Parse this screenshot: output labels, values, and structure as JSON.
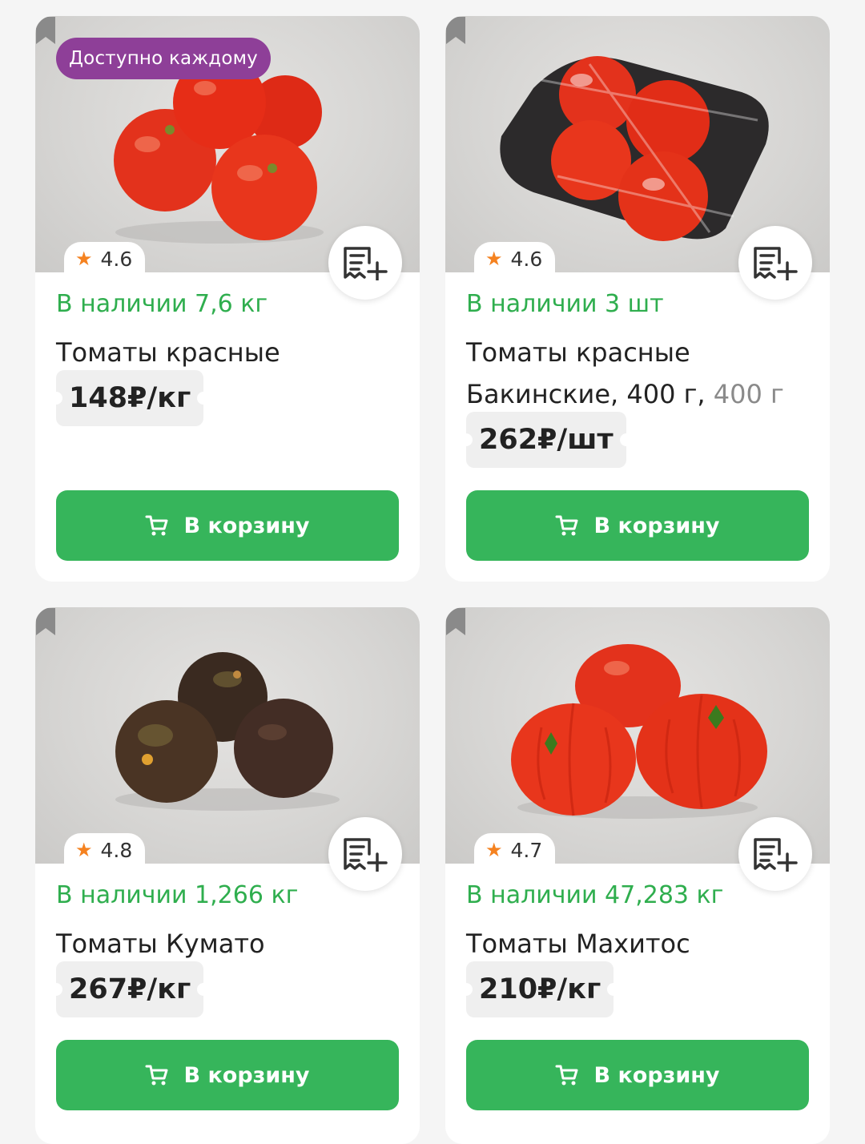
{
  "products": [
    {
      "badge": "Доступно каждому",
      "rating": "4.6",
      "stock": "В наличии 7,6 кг",
      "title": "Томаты красные",
      "weight": "",
      "price": "148₽/кг",
      "button": "В корзину"
    },
    {
      "badge": "",
      "rating": "4.6",
      "stock": "В наличии 3 шт",
      "title": "Томаты красные Бакинские, 400 г,",
      "weight": "400 г",
      "price": "262₽/шт",
      "button": "В корзину"
    },
    {
      "badge": "",
      "rating": "4.8",
      "stock": "В наличии 1,266 кг",
      "title": "Томаты Кумато",
      "weight": "",
      "price": "267₽/кг",
      "button": "В корзину"
    },
    {
      "badge": "",
      "rating": "4.7",
      "stock": "В наличии 47,283 кг",
      "title": "Томаты Махитос",
      "weight": "",
      "price": "210₽/кг",
      "button": "В корзину"
    }
  ],
  "icons": {
    "bookmark": "bookmark-icon",
    "add_to_list": "add-to-list-icon",
    "cart": "cart-icon",
    "star": "star-icon"
  },
  "colors": {
    "accent_green": "#36b55b",
    "stock_green": "#2fae4e",
    "badge_purple": "#8e3f98",
    "star_orange": "#f58220"
  }
}
